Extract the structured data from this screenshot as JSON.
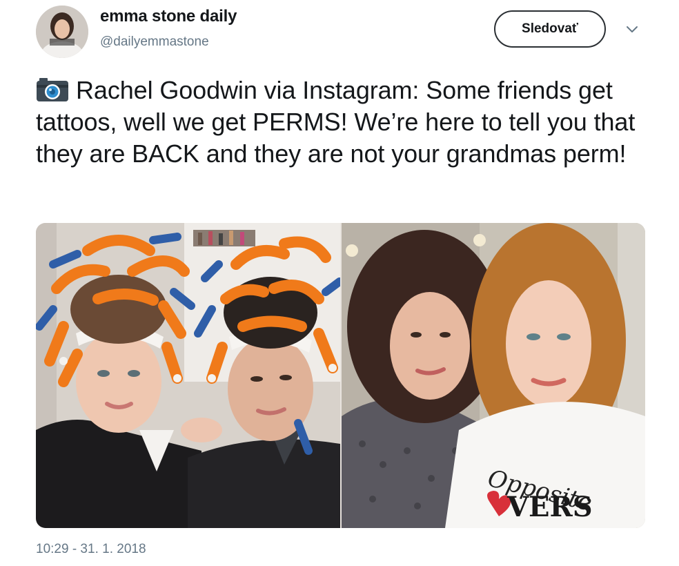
{
  "author": {
    "display_name": "emma stone daily",
    "handle": "@dailyemmastone"
  },
  "follow_button": {
    "label": "Sledovať"
  },
  "menu": {
    "icon": "chevron-down-icon"
  },
  "tweet": {
    "icon": "camera-icon",
    "text": "Rachel Goodwin via Instagram: Some friends get tattoos, well we get PERMS! We’re here to tell you that they are BACK and they are not your grandmas perm!",
    "timestamp": "10:29 - 31. 1. 2018"
  },
  "media": {
    "photos": [
      {
        "name": "perm-rollers-selfie"
      },
      {
        "name": "curly-hair-selfie",
        "shirt_text_line1": "Opposite",
        "shirt_text_line2": "VERS"
      }
    ]
  },
  "colors": {
    "text": "#14171a",
    "secondary_text": "#657786",
    "roller_orange": "#f07a1a",
    "roller_blue": "#2f5ea8"
  }
}
